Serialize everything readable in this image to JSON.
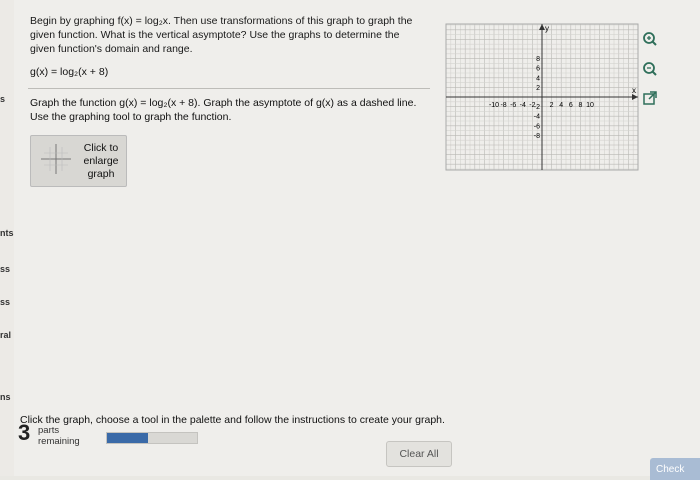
{
  "question": {
    "intro": "Begin by graphing f(x) = log₂x. Then use transformations of this graph to graph the given function. What is the vertical asymptote? Use the graphs to determine the given function's domain and range.",
    "function": "g(x) = log₂(x + 8)",
    "instruction": "Graph the function g(x) = log₂(x + 8). Graph the asymptote of g(x) as a dashed line. Use the graphing tool to graph the function."
  },
  "tool": {
    "label": "Click to enlarge graph"
  },
  "graph": {
    "x_label": "x",
    "y_label": "y",
    "x_ticks": [
      "-10",
      "-8",
      "-6",
      "-4",
      "-2",
      "2",
      "4",
      "6",
      "8",
      "10"
    ],
    "y_ticks": [
      "8",
      "6",
      "4",
      "2",
      "-2",
      "-4",
      "-6",
      "-8"
    ]
  },
  "side_fragments": [
    "s",
    "nts",
    "ss",
    "ss",
    "ral",
    "ns"
  ],
  "footer": {
    "instruction": "Click the graph, choose a tool in the palette and follow the instructions to create your graph.",
    "parts_count": "3",
    "parts_label": "parts remaining",
    "progress": 0.45,
    "clear_label": "Clear All",
    "check_label": "Check"
  }
}
